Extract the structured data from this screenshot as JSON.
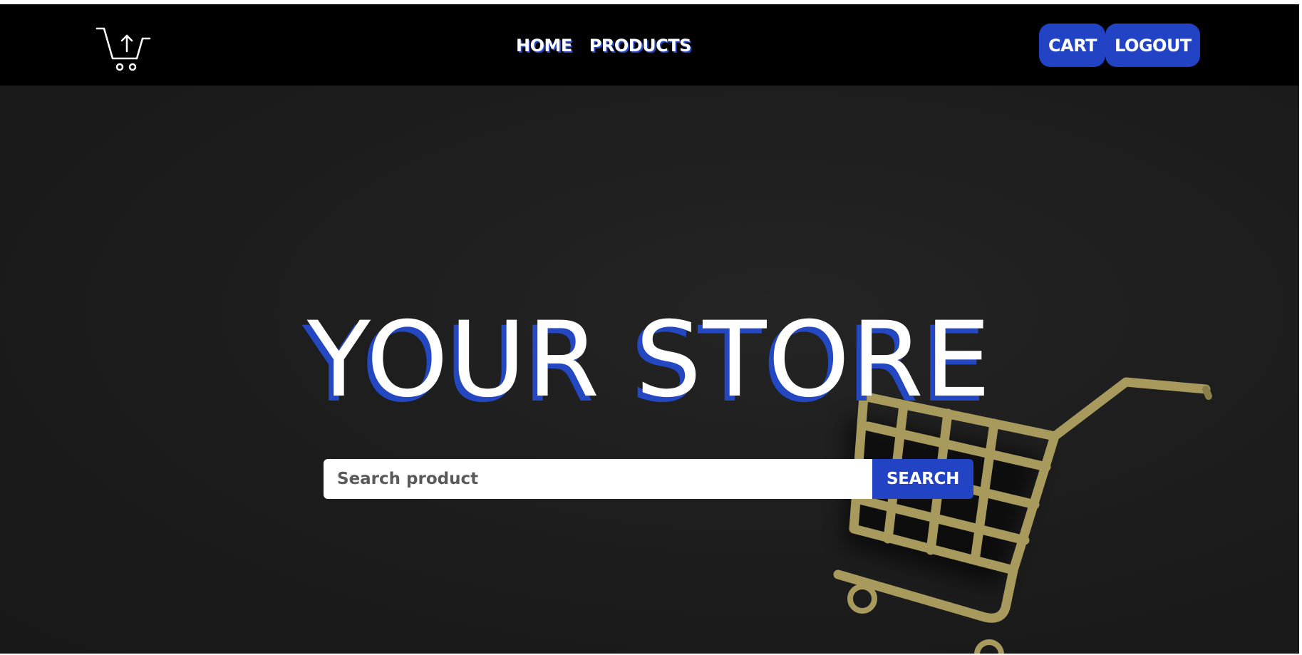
{
  "nav": {
    "logo_icon": "cart-upload-icon",
    "links": [
      {
        "label": "HOME"
      },
      {
        "label": "PRODUCTS"
      }
    ],
    "cart_label": "CART",
    "logout_label": "LOGOUT"
  },
  "hero": {
    "title": "YOUR STORE",
    "background_icon": "shopping-cart-icon",
    "search": {
      "placeholder": "Search product",
      "value": "",
      "button_label": "SEARCH"
    }
  },
  "colors": {
    "navbar": "#000000",
    "accent": "#2143c4",
    "hero_background": "#1d1d1d",
    "cart_gold": "#a89a5c",
    "text": "#ffffff"
  }
}
